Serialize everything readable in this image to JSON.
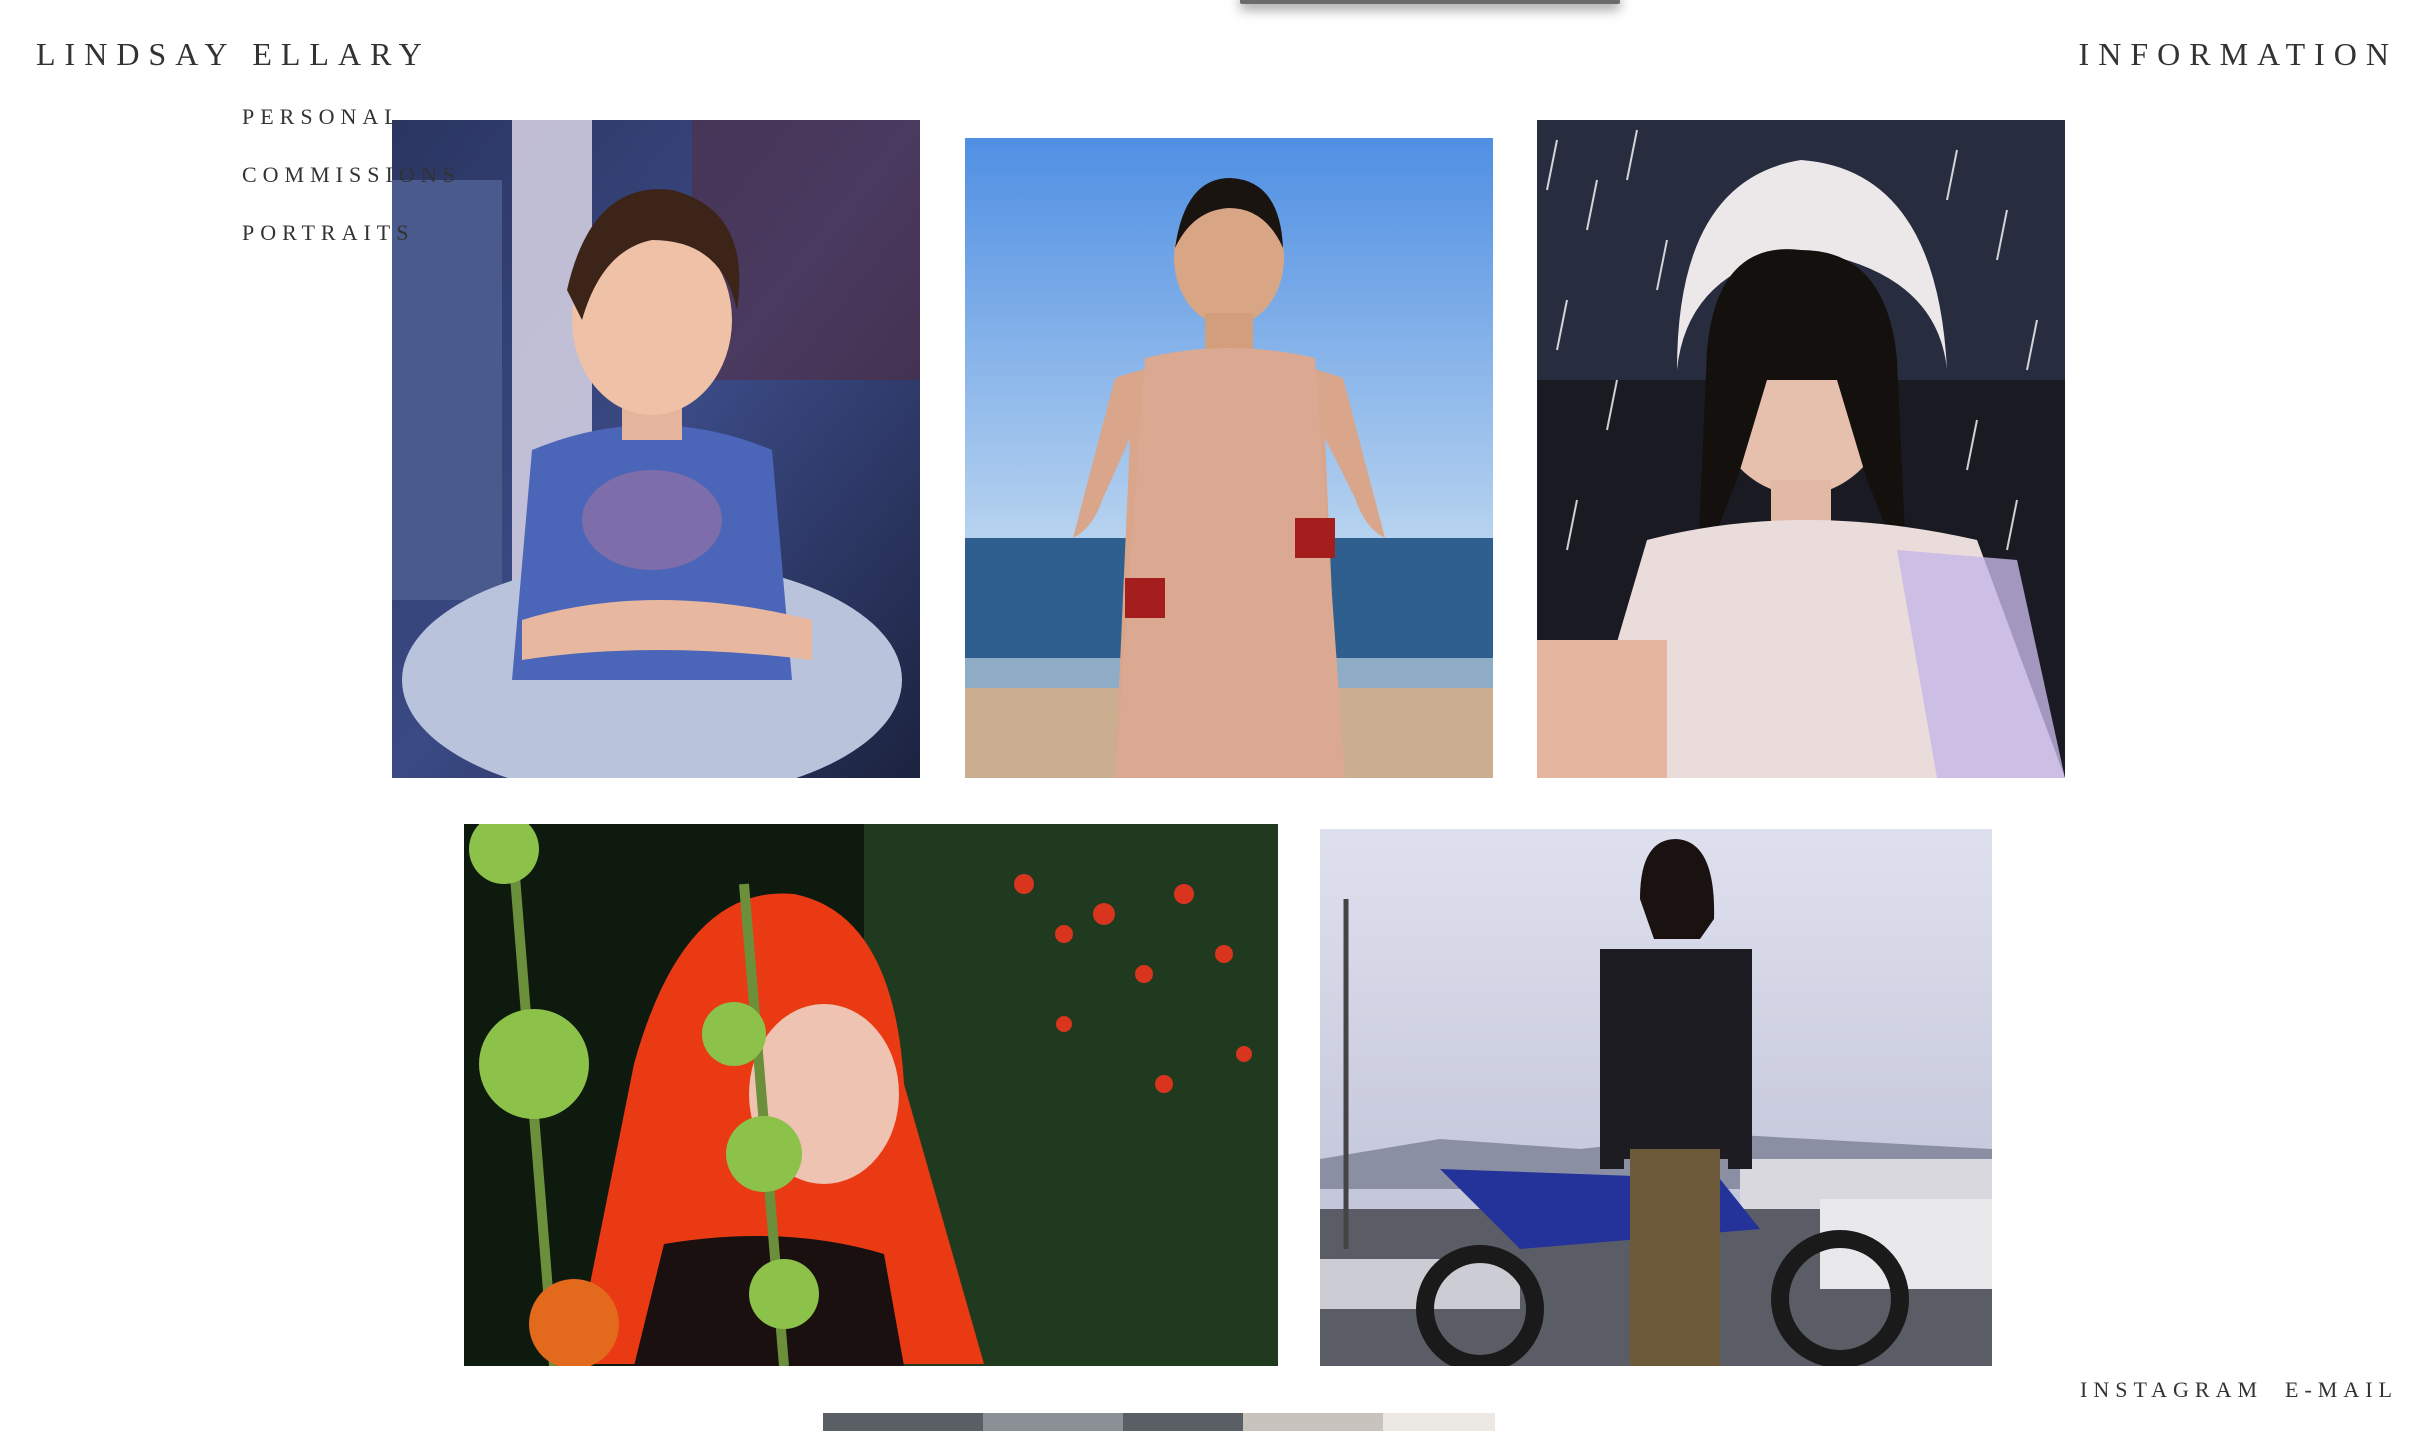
{
  "header": {
    "site_title": "LINDSAY ELLARY",
    "information_label": "INFORMATION"
  },
  "nav": {
    "items": [
      {
        "label": "PERSONAL"
      },
      {
        "label": "COMMISSIONS"
      },
      {
        "label": "PORTRAITS"
      }
    ]
  },
  "footer": {
    "instagram_label": "INSTAGRAM",
    "email_label": "E-MAIL"
  },
  "gallery": {
    "photos": [
      {
        "name": "photo-girl-blue-shirt"
      },
      {
        "name": "photo-woman-beach-knit-dress"
      },
      {
        "name": "photo-girl-rain-bonnet"
      },
      {
        "name": "photo-red-hair-flowers"
      },
      {
        "name": "photo-person-motorcycle"
      },
      {
        "name": "photo-partial-bottom"
      }
    ]
  }
}
